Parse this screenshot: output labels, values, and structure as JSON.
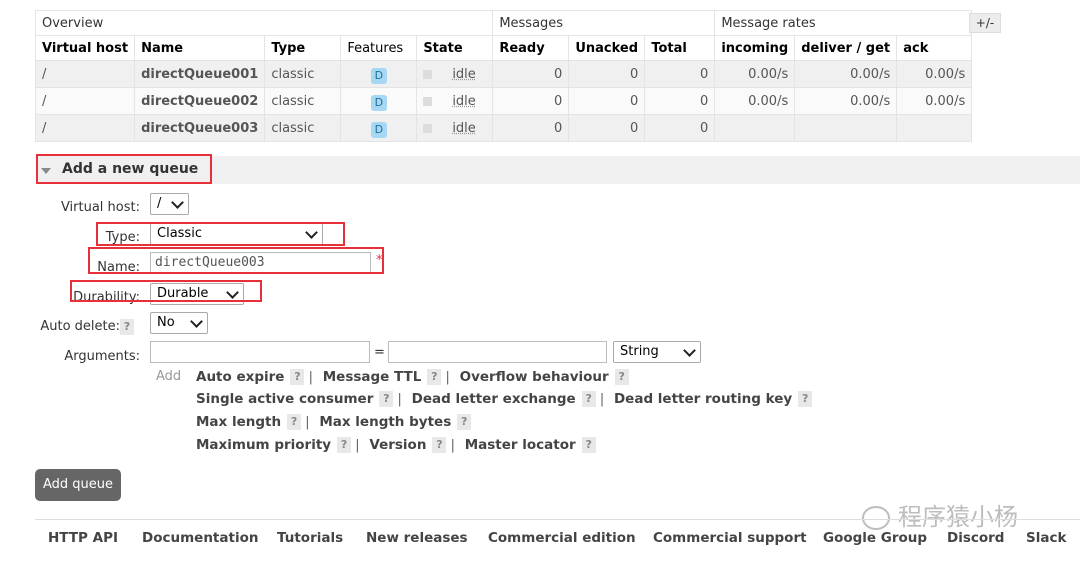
{
  "table": {
    "groups": {
      "overview": "Overview",
      "messages": "Messages",
      "rates": "Message rates"
    },
    "columns": [
      "Virtual host",
      "Name",
      "Type",
      "Features",
      "State",
      "Ready",
      "Unacked",
      "Total",
      "incoming",
      "deliver / get",
      "ack"
    ],
    "toggle": "+/-",
    "rows": [
      {
        "vhost": "/",
        "name": "directQueue001",
        "type": "classic",
        "feature": "D",
        "state": "idle",
        "ready": "0",
        "unacked": "0",
        "total": "0",
        "incoming": "0.00/s",
        "deliver": "0.00/s",
        "ack": "0.00/s"
      },
      {
        "vhost": "/",
        "name": "directQueue002",
        "type": "classic",
        "feature": "D",
        "state": "idle",
        "ready": "0",
        "unacked": "0",
        "total": "0",
        "incoming": "0.00/s",
        "deliver": "0.00/s",
        "ack": "0.00/s"
      },
      {
        "vhost": "/",
        "name": "directQueue003",
        "type": "classic",
        "feature": "D",
        "state": "idle",
        "ready": "0",
        "unacked": "0",
        "total": "0",
        "incoming": "",
        "deliver": "",
        "ack": ""
      }
    ]
  },
  "form": {
    "section_title": "Add a new queue",
    "vhost_label": "Virtual host:",
    "vhost_value": "/",
    "type_label": "Type:",
    "type_value": "Classic",
    "name_label": "Name:",
    "name_value": "directQueue003",
    "required_mark": "*",
    "durability_label": "Durability:",
    "durability_value": "Durable",
    "autodelete_label": "Auto delete:",
    "autodelete_help": "?",
    "autodelete_value": "No",
    "arguments_label": "Arguments:",
    "equals": "=",
    "arg_type_value": "String",
    "add_label": "Add",
    "help": "?",
    "arg_line1": [
      "Auto expire",
      "Message TTL",
      "Overflow behaviour"
    ],
    "arg_line2": [
      "Single active consumer",
      "Dead letter exchange",
      "Dead letter routing key"
    ],
    "arg_line3": [
      "Max length",
      "Max length bytes"
    ],
    "arg_line4": [
      "Maximum priority",
      "Version",
      "Master locator"
    ],
    "submit": "Add queue"
  },
  "footer": {
    "links": [
      "HTTP API",
      "Documentation",
      "Tutorials",
      "New releases",
      "Commercial edition",
      "Commercial support",
      "Google Group",
      "Discord",
      "Slack"
    ]
  },
  "watermark": "程序猿小杨",
  "colors": {
    "highlight": "#e8303a",
    "feature_badge": "#a6d8f3",
    "button": "#666666"
  }
}
